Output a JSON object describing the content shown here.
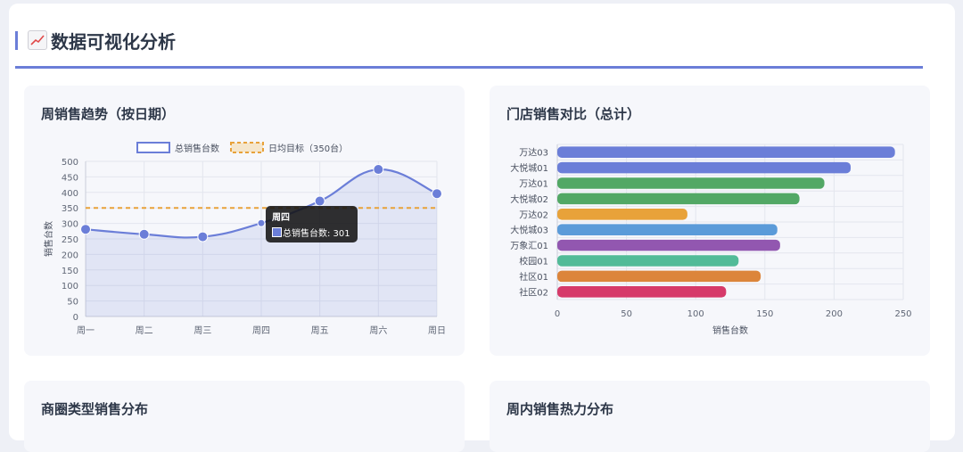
{
  "section": {
    "title": "数据可视化分析",
    "icon": "chart-increasing-icon"
  },
  "cards": {
    "weekly": {
      "title": "周销售趋势（按日期）"
    },
    "store": {
      "title": "门店销售对比（总计）"
    },
    "district": {
      "title": "商圈类型销售分布"
    },
    "heatmap": {
      "title": "周内销售热力分布"
    }
  },
  "tooltip": {
    "title": "周四",
    "label": "总销售台数: 301"
  },
  "chart_data": [
    {
      "type": "line",
      "title": "周销售趋势（按日期）",
      "categories": [
        "周一",
        "周二",
        "周三",
        "周四",
        "周五",
        "周六",
        "周日"
      ],
      "series": [
        {
          "name": "总销售台数",
          "values": [
            281,
            265,
            257,
            301,
            372,
            474,
            396
          ],
          "color": "#6b7ed8",
          "fill": "rgba(107,126,216,0.15)"
        },
        {
          "name": "日均目标（350台）",
          "values": [
            350,
            350,
            350,
            350,
            350,
            350,
            350
          ],
          "color": "#e8a23a",
          "dashed": true
        }
      ],
      "ylabel": "销售台数",
      "ylim": [
        0,
        500
      ],
      "yticks": [
        0,
        50,
        100,
        150,
        200,
        250,
        300,
        350,
        400,
        450,
        500
      ],
      "legend": "top",
      "grid": true
    },
    {
      "type": "bar",
      "orientation": "horizontal",
      "title": "门店销售对比（总计）",
      "categories": [
        "万达03",
        "大悦城01",
        "万达01",
        "大悦城02",
        "万达02",
        "大悦城03",
        "万象汇01",
        "校园01",
        "社区01",
        "社区02"
      ],
      "values": [
        244,
        212,
        193,
        175,
        94,
        159,
        161,
        131,
        147,
        122
      ],
      "colors": [
        "#6b7ed8",
        "#6b7ed8",
        "#52a865",
        "#52a865",
        "#e8a23a",
        "#5b9bd9",
        "#9257b0",
        "#52bb98",
        "#dc853b",
        "#d63a6a"
      ],
      "xlabel": "销售台数",
      "xlim": [
        0,
        250
      ],
      "xticks": [
        0,
        50,
        100,
        150,
        200,
        250
      ],
      "grid": true
    }
  ]
}
